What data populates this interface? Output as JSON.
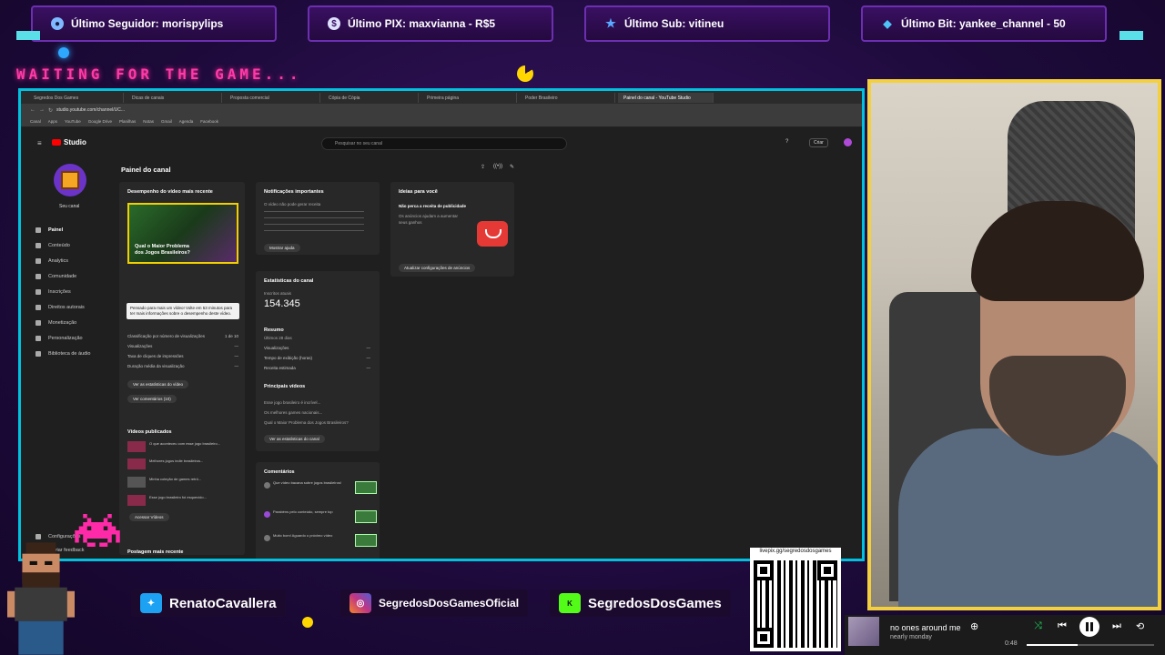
{
  "alerts": [
    {
      "label": "Último Seguidor: morispylips",
      "icon": "user-icon",
      "color": "#9fd3ff"
    },
    {
      "label": "Último PIX: maxvianna - R$5",
      "icon": "dollar-icon",
      "color": "#ffffff"
    },
    {
      "label": "Último Sub: vitineu",
      "icon": "star-icon",
      "color": "#5aa8ff"
    },
    {
      "label": "Último Bit: yankee_channel - 50",
      "icon": "diamond-icon",
      "color": "#4fc3f7"
    }
  ],
  "waiting_text": "WAITING FOR THE GAME...",
  "browser": {
    "tabs": [
      "Segredos Dos Games",
      "Dicas de canais",
      "Proposta comercial",
      "Cópia de Cópia",
      "Primeira página",
      "Poder Brasileiro",
      "Painel do canal - YouTube Studio"
    ],
    "url": "studio.youtube.com/channel/UC...",
    "bookmarks": [
      "Canal",
      "Apps",
      "YouTube",
      "Google Drive",
      "Planilhas",
      "Notas",
      "Gmail",
      "Agenda",
      "Facebook"
    ]
  },
  "studio": {
    "logo": "Studio",
    "search_placeholder": "Pesquisar no seu canal",
    "create_label": "Criar",
    "channel_name": "Seu canal",
    "page_title": "Painel do canal",
    "nav": [
      "Painel",
      "Conteúdo",
      "Analytics",
      "Comunidade",
      "Inscrições",
      "Direitos autorais",
      "Monetização",
      "Personalização",
      "Biblioteca de áudio"
    ],
    "nav_footer": [
      "Configurações",
      "Enviar feedback"
    ],
    "latest_video": {
      "title": "Desempenho do vídeo mais recente",
      "thumb_text": "Qual o Maior Problema dos Jogos Brasileiros?",
      "tooltip": "Pensado para mais um vídeo! Volte em 53 minutos para ter mais informações sobre o desempenho deste vídeo.",
      "metrics": [
        {
          "label": "Classificação por número de visualizações",
          "value": "1 de 10"
        },
        {
          "label": "Visualizações",
          "value": "—"
        },
        {
          "label": "Taxa de cliques de impressões",
          "value": "—"
        },
        {
          "label": "Duração média da visualização",
          "value": "—"
        }
      ],
      "btn_analytics": "Ver as estatísticas do vídeo",
      "btn_comments": "Ver comentários (10)"
    },
    "published": {
      "title": "Vídeos publicados",
      "items": [
        "O que aconteceu com esse jogo brasileiro...",
        "Melhores jogos indie brasileiros...",
        "Minha coleção de games retrô...",
        "Esse jogo brasileiro foi esquecido..."
      ],
      "btn_more": "Acessar Vídeos"
    },
    "latest_post": "Postagem mais recente",
    "notifications": {
      "title": "Notificações importantes",
      "text": "O vídeo não pode gerar receita",
      "btn": "Mostrar ajuda"
    },
    "stats": {
      "title": "Estatísticas do canal",
      "subs_label": "Inscritos atuais",
      "subs_value": "154.345",
      "summary_title": "Resumo",
      "summary_sub": "Últimos 28 dias",
      "rows": [
        {
          "label": "Visualizações",
          "value": "—"
        },
        {
          "label": "Tempo de exibição (horas)",
          "value": "—"
        },
        {
          "label": "Receita estimada",
          "value": "—"
        }
      ],
      "top_title": "Principais vídeos",
      "top_rows": [
        "Esse jogo brasileiro é incrível...",
        "Os melhores games nacionais...",
        "Qual o Maior Problema dos Jogos Brasileiros?"
      ],
      "btn": "Ver as estatísticas do canal"
    },
    "comments": {
      "title": "Comentários",
      "items": [
        "Que vídeo bacana sobre jogos brasileiros!",
        "Parabéns pelo conteúdo, sempre top",
        "Muito bom! Aguardo o próximo vídeo"
      ]
    },
    "ideas": {
      "title": "Ideias para você",
      "headline": "Não perca a receita de publicidade",
      "text": "Os anúncios ajudam a aumentar seus ganhos",
      "btn": "Atualizar configurações de anúncios"
    }
  },
  "socials": [
    {
      "name": "RenatoCavallera",
      "icon": "twitter-icon",
      "color": "#1da1f2"
    },
    {
      "name": "SegredosDosGamesOficial",
      "icon": "instagram-icon",
      "color": "#c13584"
    },
    {
      "name": "SegredosDosGames",
      "icon": "kick-icon",
      "color": "#53fc18"
    }
  ],
  "qr_url": "livepix.gg/segredosdosgames",
  "player": {
    "song": "no ones around me",
    "artist": "nearly monday",
    "time": "0:48",
    "progress": 0.4
  }
}
